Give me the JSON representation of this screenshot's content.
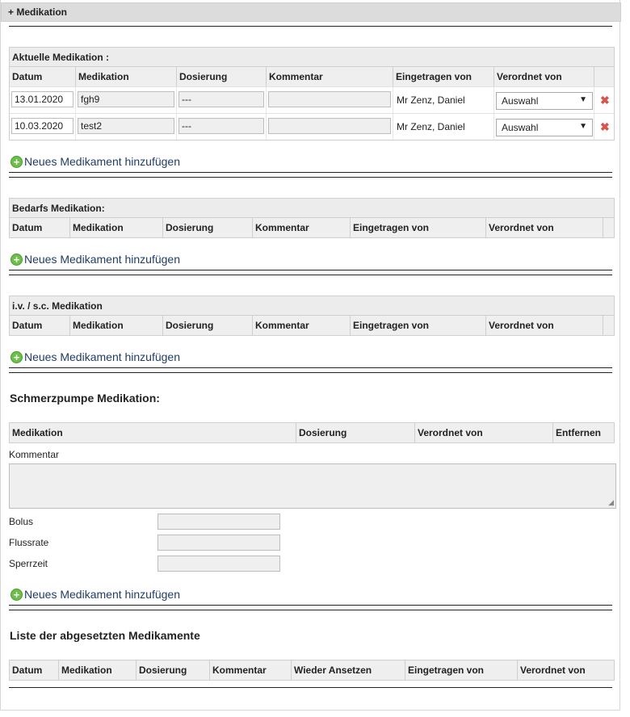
{
  "panel": {
    "title": "+ Medikation"
  },
  "aktuelle": {
    "title": "Aktuelle Medikation :",
    "columns": [
      "Datum",
      "Medikation",
      "Dosierung",
      "Kommentar",
      "Eingetragen von",
      "Verordnet von",
      ""
    ],
    "rows": [
      {
        "datum": "13.01.2020",
        "medikation": "fgh9",
        "dosierung": "---",
        "kommentar": "",
        "eingetragen": "Mr Zenz, Daniel",
        "verordnet": "Auswahl"
      },
      {
        "datum": "10.03.2020",
        "medikation": "test2",
        "dosierung": "---",
        "kommentar": "",
        "eingetragen": "Mr Zenz, Daniel",
        "verordnet": "Auswahl"
      }
    ]
  },
  "add_link": "Neues Medikament hinzufügen",
  "bedarf": {
    "title": "Bedarfs Medikation:",
    "columns": [
      "Datum",
      "Medikation",
      "Dosierung",
      "Kommentar",
      "Eingetragen von",
      "Verordnet von",
      ""
    ]
  },
  "iv": {
    "title": "i.v. / s.c. Medikation",
    "columns": [
      "Datum",
      "Medikation",
      "Dosierung",
      "Kommentar",
      "Eingetragen von",
      "Verordnet von",
      ""
    ]
  },
  "schmerz": {
    "title": "Schmerzpumpe Medikation:",
    "columns": [
      "Medikation",
      "Dosierung",
      "Verordnet von",
      "Entfernen"
    ],
    "kommentar_label": "Kommentar",
    "bolus_label": "Bolus",
    "flussrate_label": "Flussrate",
    "sperrzeit_label": "Sperrzeit"
  },
  "abgesetzt": {
    "title": "Liste der abgesetzten Medikamente",
    "columns": [
      "Datum",
      "Medikation",
      "Dosierung",
      "Kommentar",
      "Wieder Ansetzen",
      "Eingetragen von",
      "Verordnet von"
    ]
  },
  "icons": {
    "add": "plus-circle-icon",
    "delete": "close-icon",
    "dropdown": "chevron-down-icon"
  },
  "colors": {
    "add_icon": "#6cc04a",
    "delete_icon": "#d9534f",
    "link": "#1f3d66"
  }
}
